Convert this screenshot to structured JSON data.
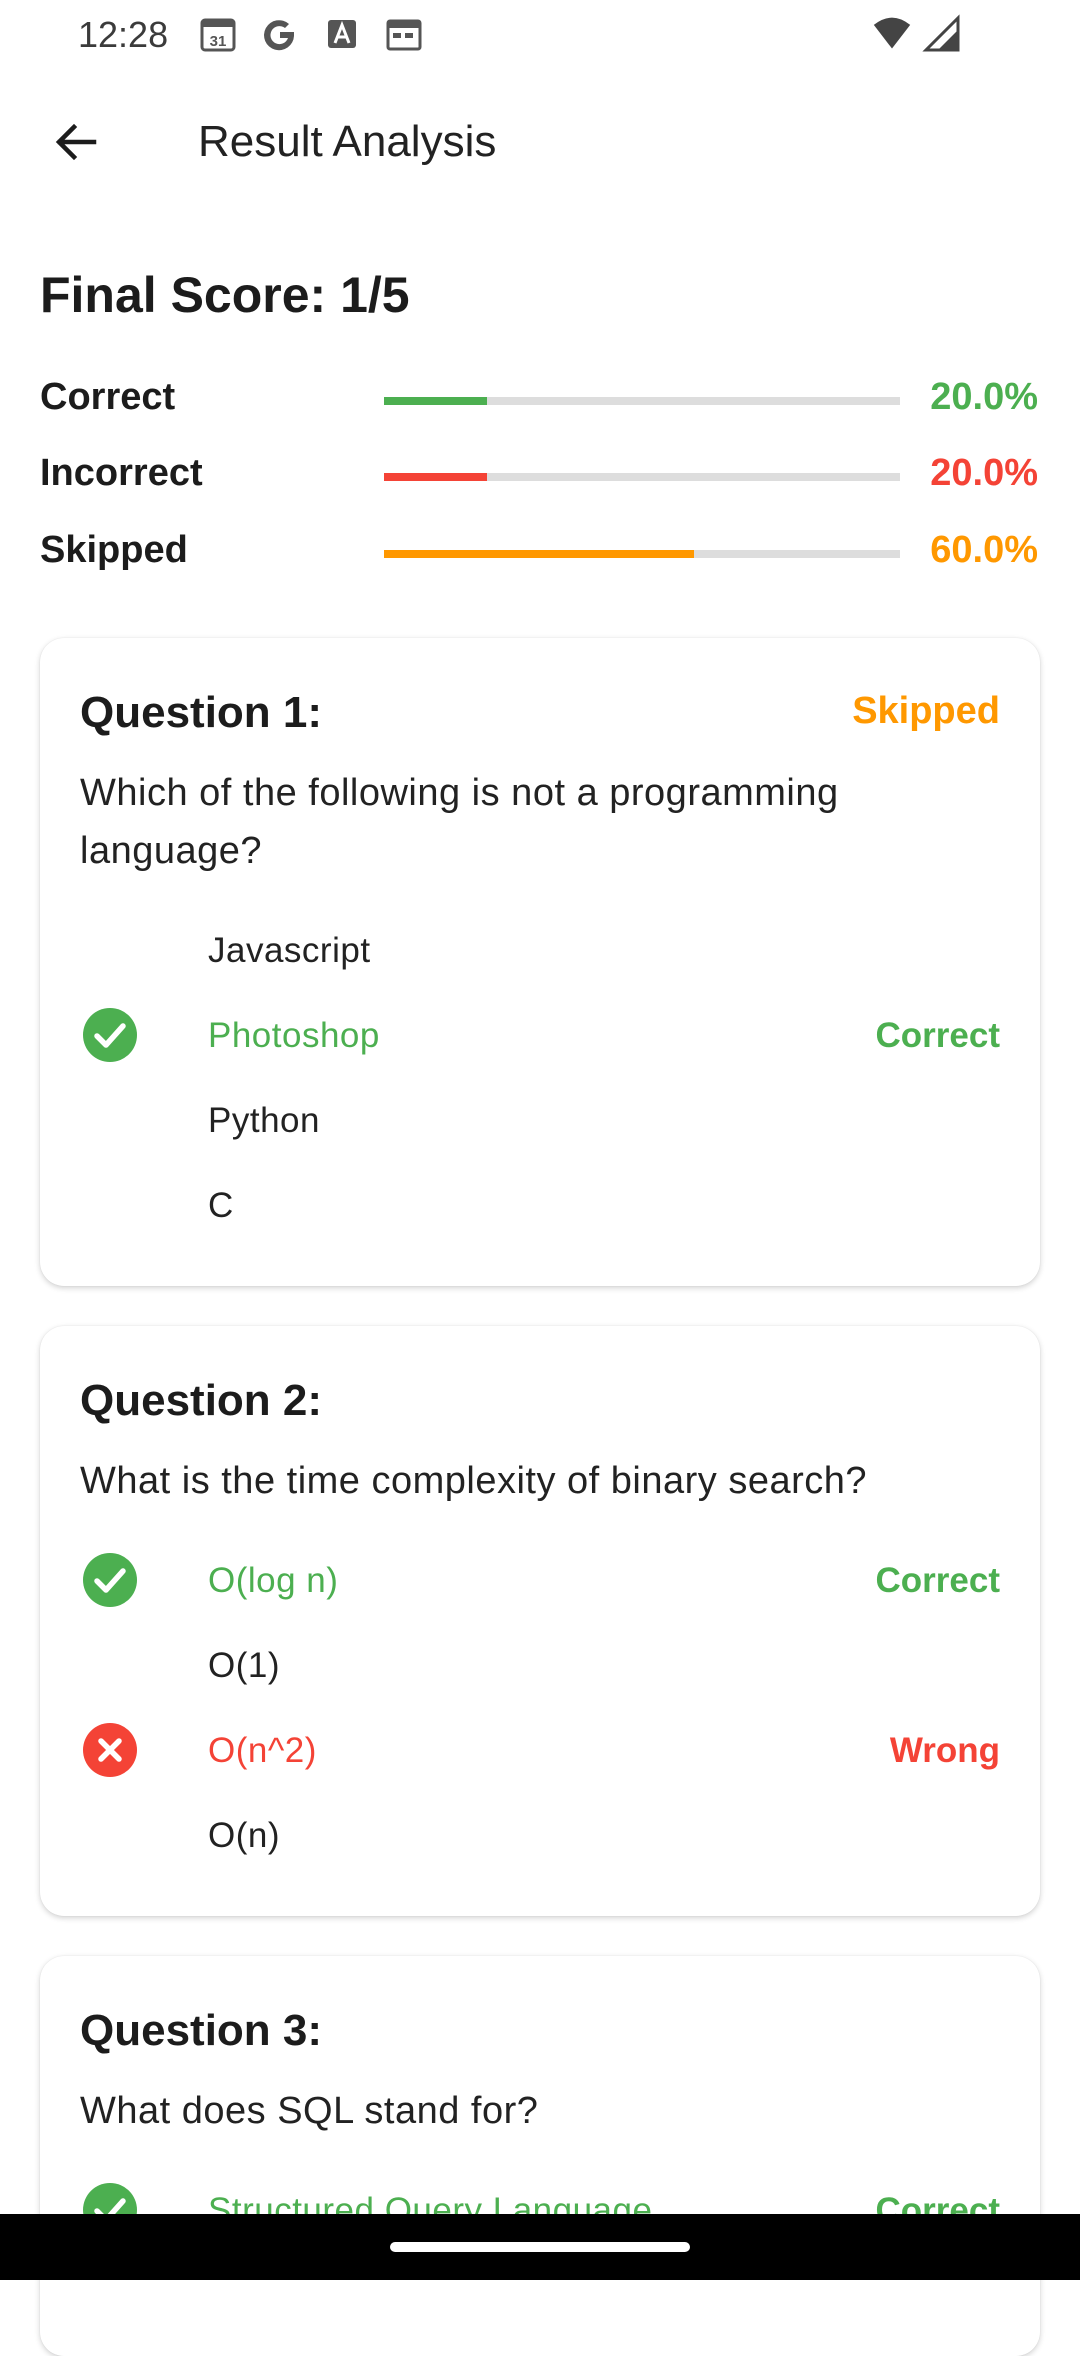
{
  "status_bar": {
    "time": "12:28",
    "calendar_day": "31"
  },
  "header": {
    "title": "Result Analysis"
  },
  "score": {
    "final_label": "Final Score: 1/5",
    "stats": [
      {
        "label": "Correct",
        "value": "20.0%",
        "fraction": 0.2,
        "color": "#4caf50"
      },
      {
        "label": "Incorrect",
        "value": "20.0%",
        "fraction": 0.2,
        "color": "#f44336"
      },
      {
        "label": "Skipped",
        "value": "60.0%",
        "fraction": 0.6,
        "color": "#ff9800"
      }
    ]
  },
  "questions": [
    {
      "title": "Question 1:",
      "status": "Skipped",
      "status_color": "#ff9800",
      "text": "Which of the following is not a programming language?",
      "options": [
        {
          "text": "Javascript",
          "state": "none",
          "result": ""
        },
        {
          "text": "Photoshop",
          "state": "correct",
          "result": "Correct"
        },
        {
          "text": "Python",
          "state": "none",
          "result": ""
        },
        {
          "text": "C",
          "state": "none",
          "result": ""
        }
      ]
    },
    {
      "title": "Question 2:",
      "status": "",
      "status_color": "#ff9800",
      "text": "What is the time complexity of binary search?",
      "options": [
        {
          "text": "O(log n)",
          "state": "correct",
          "result": "Correct"
        },
        {
          "text": "O(1)",
          "state": "none",
          "result": ""
        },
        {
          "text": "O(n^2)",
          "state": "wrong",
          "result": "Wrong"
        },
        {
          "text": "O(n)",
          "state": "none",
          "result": ""
        }
      ]
    },
    {
      "title": "Question 3:",
      "status": "",
      "status_color": "#ff9800",
      "text": "What does SQL stand for?",
      "options": [
        {
          "text": "Structured Query Language",
          "state": "correct",
          "result": "Correct"
        }
      ]
    }
  ],
  "colors": {
    "correct": "#4caf50",
    "wrong": "#f44336",
    "skipped": "#ff9800"
  }
}
